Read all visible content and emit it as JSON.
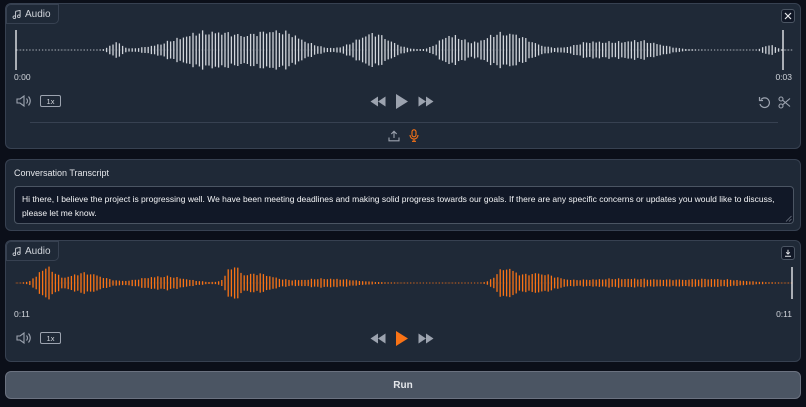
{
  "input_audio": {
    "label": "Audio",
    "time_start": "0:00",
    "time_end": "0:03",
    "playback_rate": "1x",
    "wave_color": "#d1d5db",
    "icons": [
      "music-note-icon",
      "close-icon",
      "volume-icon",
      "skip-back-icon",
      "play-icon",
      "skip-forward-icon",
      "undo-icon",
      "scissors-icon",
      "upload-icon",
      "microphone-icon"
    ]
  },
  "transcript": {
    "label": "Conversation Transcript",
    "value": "Hi there, I believe the project is progressing well. We have been meeting deadlines and making solid progress towards our goals. If there are any specific concerns or updates you would like to discuss, please let me know."
  },
  "output_audio": {
    "label": "Audio",
    "time_start": "0:11",
    "time_end": "0:11",
    "playback_rate": "1x",
    "wave_color": "#f97316",
    "icons": [
      "music-note-icon",
      "download-icon",
      "volume-icon",
      "skip-back-icon",
      "play-icon",
      "skip-forward-icon"
    ]
  },
  "run_button": {
    "label": "Run"
  },
  "colors": {
    "background": "#0b0f19",
    "panel": "#1f2937",
    "accent": "#f97316"
  }
}
